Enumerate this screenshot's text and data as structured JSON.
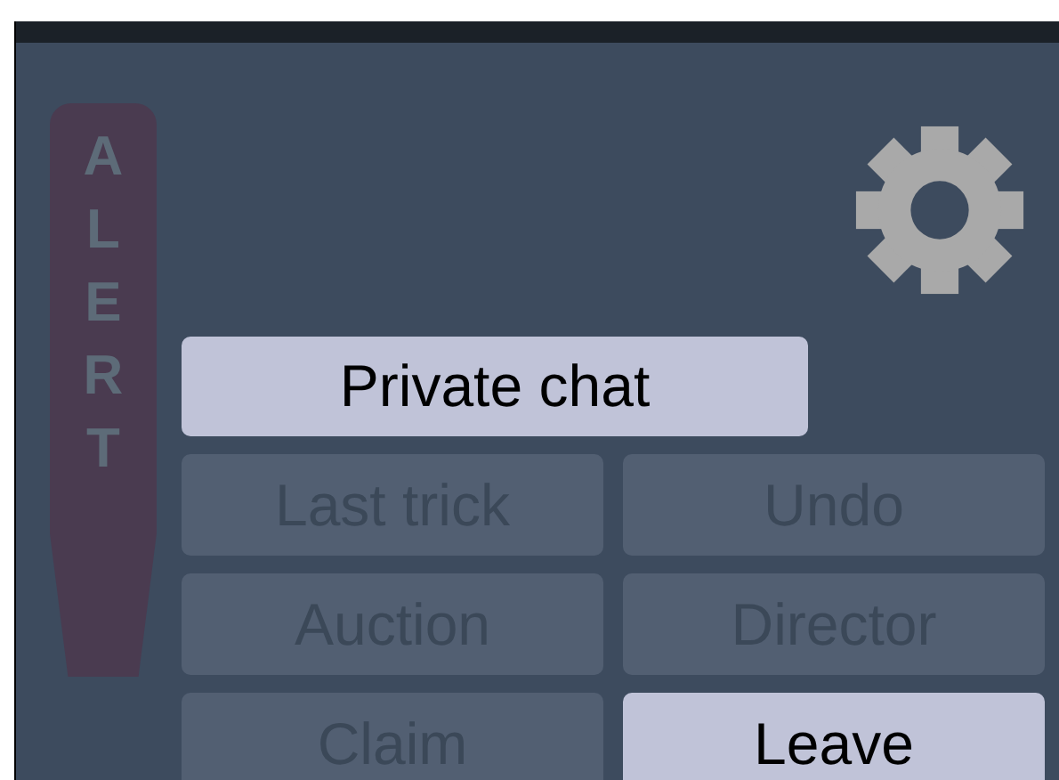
{
  "alert": {
    "label": "ALERT",
    "active": false
  },
  "chat_button": {
    "label": "Private chat",
    "enabled": true
  },
  "buttons": [
    {
      "label": "Last trick",
      "enabled": false
    },
    {
      "label": "Undo",
      "enabled": false
    },
    {
      "label": "Auction",
      "enabled": false
    },
    {
      "label": "Director",
      "enabled": false
    },
    {
      "label": "Claim",
      "enabled": false
    },
    {
      "label": "Leave",
      "enabled": true
    }
  ]
}
